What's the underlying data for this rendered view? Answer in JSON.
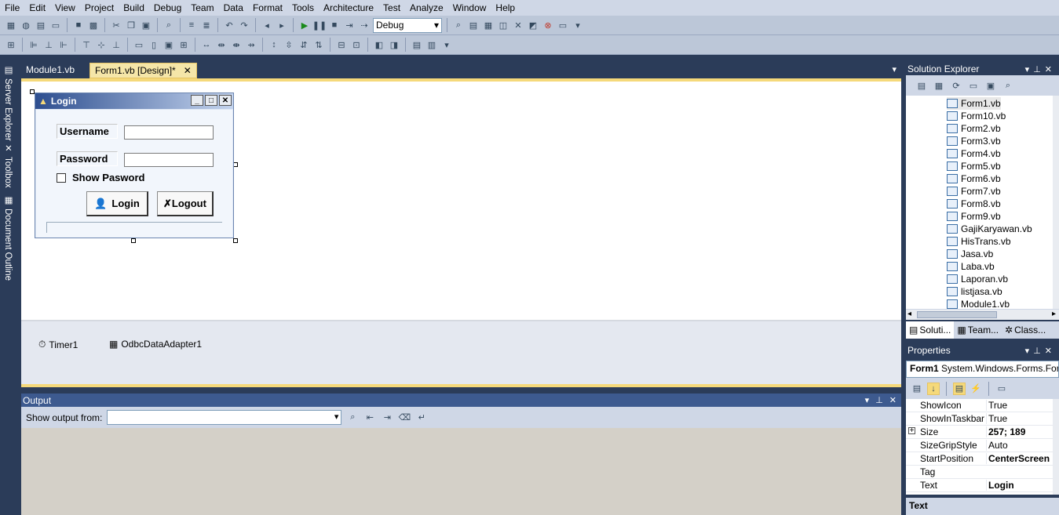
{
  "menu": [
    "File",
    "Edit",
    "View",
    "Project",
    "Build",
    "Debug",
    "Team",
    "Data",
    "Format",
    "Tools",
    "Architecture",
    "Test",
    "Analyze",
    "Window",
    "Help"
  ],
  "toolbar": {
    "config": "Debug"
  },
  "left_tabs": [
    "Server Explorer",
    "Toolbox",
    "Document Outline"
  ],
  "doc_tabs": [
    {
      "label": "Module1.vb"
    },
    {
      "label": "Form1.vb [Design]*"
    }
  ],
  "form": {
    "title": "Login",
    "username_label": "Username",
    "password_label": "Password",
    "show_password": "Show Pasword",
    "login_button": "Login",
    "logout_button": "Logout"
  },
  "tray": {
    "items": [
      "Timer1",
      "OdbcDataAdapter1"
    ]
  },
  "solution_explorer": {
    "title": "Solution Explorer",
    "files": [
      "Form1.vb",
      "Form10.vb",
      "Form2.vb",
      "Form3.vb",
      "Form4.vb",
      "Form5.vb",
      "Form6.vb",
      "Form7.vb",
      "Form8.vb",
      "Form9.vb",
      "GajiKaryawan.vb",
      "HisTrans.vb",
      "Jasa.vb",
      "Laba.vb",
      "Laporan.vb",
      "listjasa.vb",
      "Module1.vb"
    ],
    "bottom_tabs": [
      "Soluti...",
      "Team...",
      "Class..."
    ]
  },
  "properties": {
    "title": "Properties",
    "object_name": "Form1",
    "object_type": "System.Windows.Forms.Form",
    "rows": [
      {
        "name": "ShowIcon",
        "value": "True"
      },
      {
        "name": "ShowInTaskbar",
        "value": "True"
      },
      {
        "name": "Size",
        "value": "257; 189"
      },
      {
        "name": "SizeGripStyle",
        "value": "Auto"
      },
      {
        "name": "StartPosition",
        "value": "CenterScreen"
      },
      {
        "name": "Tag",
        "value": ""
      },
      {
        "name": "Text",
        "value": "Login"
      }
    ],
    "description_title": "Text"
  },
  "output": {
    "title": "Output",
    "show_from_label": "Show output from:"
  }
}
